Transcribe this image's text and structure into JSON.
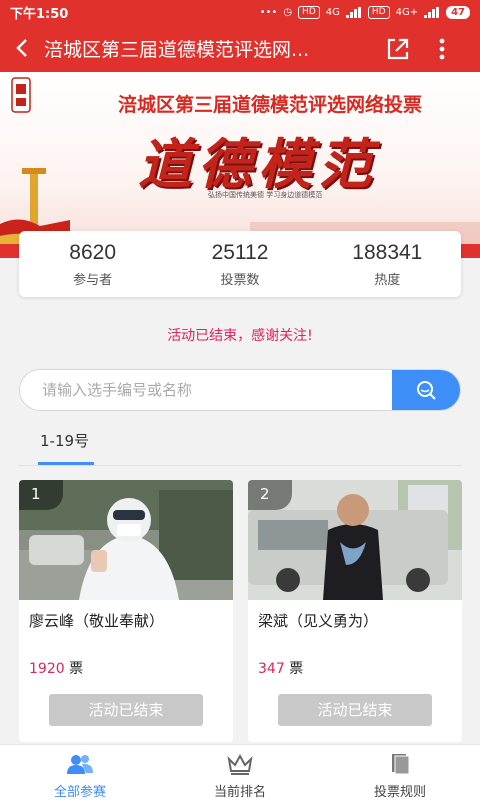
{
  "status_bar": {
    "time": "下午1:50",
    "network_1": "HD",
    "signal_1": "4G",
    "network_2": "HD",
    "signal_2": "4G+",
    "battery": "47"
  },
  "header": {
    "title": "涪城区第三届道德模范评选网..."
  },
  "banner": {
    "title": "涪城区第三届道德模范评选网络投票",
    "big_title": "道德模范",
    "subtitle": "弘扬中国传统美德    学习身边道德模范"
  },
  "stats": [
    {
      "value": "8620",
      "label": "参与者"
    },
    {
      "value": "25112",
      "label": "投票数"
    },
    {
      "value": "188341",
      "label": "热度"
    }
  ],
  "notice": "活动已结束，感谢关注!",
  "search": {
    "placeholder": "请输入选手编号或名称"
  },
  "group_tab": "1-19号",
  "candidates": [
    {
      "number": "1",
      "name": "廖云峰（敬业奉献）",
      "votes": "1920",
      "unit": "票",
      "button": "活动已结束"
    },
    {
      "number": "2",
      "name": "梁斌（见义勇为）",
      "votes": "347",
      "unit": "票",
      "button": "活动已结束"
    }
  ],
  "nav": [
    {
      "label": "全部参赛",
      "icon": "users-icon",
      "active": true
    },
    {
      "label": "当前排名",
      "icon": "crown-icon",
      "active": false
    },
    {
      "label": "投票规则",
      "icon": "document-icon",
      "active": false
    }
  ],
  "colors": {
    "brand_red": "#e0312c",
    "accent_blue": "#3d8ef7",
    "highlight_pink": "#e0245e",
    "disabled_gray": "#c8c8c8"
  }
}
